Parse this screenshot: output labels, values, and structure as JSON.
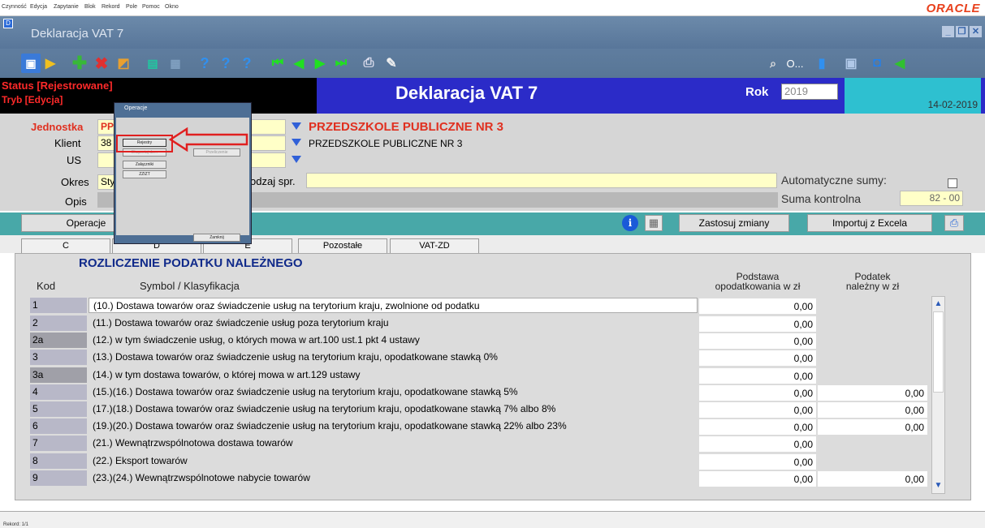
{
  "menu": {
    "items": [
      "Czynność",
      "Edycja",
      "Zapytanie",
      "Blok",
      "Rekord",
      "Pole",
      "Pomoc",
      "Okno"
    ],
    "brand": "ORACLE"
  },
  "window": {
    "title": "Deklaracja VAT 7",
    "icon_label": "D"
  },
  "toolbar": {
    "icons": [
      "save-icon",
      "open-icon",
      "insert-record-icon",
      "delete-record-icon",
      "clear-icon",
      "list-icon",
      "block-icon",
      "query-icon",
      "query-execute-icon",
      "query-count-icon",
      "first-record-icon",
      "prev-record-icon",
      "next-record-icon",
      "last-record-icon",
      "print-icon",
      "edit-icon",
      "zoom-icon",
      "info-icon",
      "window-icon",
      "close-form-icon",
      "exit-icon"
    ],
    "more_label": "O..."
  },
  "status": {
    "line1": "Status [Rejestrowane]",
    "line2": "Tryb [Edycja]",
    "title": "Deklaracja VAT 7",
    "rok_label": "Rok",
    "rok_value": "2019",
    "date": "14-02-2019"
  },
  "header": {
    "jednostka_label": "Jednostka",
    "jednostka_value": "PP",
    "jednostka_name": "PRZEDSZKOLE PUBLICZNE NR 3",
    "klient_label": "Klient",
    "klient_value": "38",
    "klient_name": "PRZEDSZKOLE PUBLICZNE NR 3",
    "us_label": "US",
    "okres_label": "Okres",
    "okres_value": "Sty",
    "rodzaj_label": "odzaj spr.",
    "opis_label": "Opis",
    "auto_label": "Automatyczne sumy:",
    "suma_label": "Suma kontrolna",
    "suma_value": "82 - 00"
  },
  "opbar": {
    "operacje": "Operacje",
    "zastosuj": "Zastosuj zmiany",
    "importuj": "Importuj z Excela"
  },
  "tabs": [
    "C",
    "D",
    "E",
    "Pozostałe",
    "VAT-ZD"
  ],
  "table": {
    "section_title": "ROZLICZENIE PODATKU NALEŻNEGO",
    "col_kod": "Kod",
    "col_symbol": "Symbol / Klasyfikacja",
    "col_podstawa_1": "Podstawa",
    "col_podstawa_2": "opodatkowania w zł",
    "col_podatek_1": "Podatek",
    "col_podatek_2": "należny w zł",
    "rows": [
      {
        "kod": "1",
        "desc": "(10.) Dostawa towarów oraz świadczenie usług na terytorium kraju, zwolnione od podatku",
        "v1": "0,00",
        "v2": ""
      },
      {
        "kod": "2",
        "desc": "(11.) Dostawa towarów oraz świadczenie usług poza terytorium kraju",
        "v1": "0,00",
        "v2": ""
      },
      {
        "kod": "2a",
        "desc": "(12.) w tym świadczenie usług, o których mowa w art.100 ust.1 pkt 4 ustawy",
        "v1": "0,00",
        "v2": ""
      },
      {
        "kod": "3",
        "desc": "(13.) Dostawa towarów oraz świadczenie usług na terytorium kraju, opodatkowane stawką 0%",
        "v1": "0,00",
        "v2": ""
      },
      {
        "kod": "3a",
        "desc": "(14.) w tym dostawa towarów, o której mowa w art.129 ustawy",
        "v1": "0,00",
        "v2": ""
      },
      {
        "kod": "4",
        "desc": "(15.)(16.) Dostawa towarów oraz świadczenie usług na terytorium kraju, opodatkowane stawką 5%",
        "v1": "0,00",
        "v2": "0,00"
      },
      {
        "kod": "5",
        "desc": "(17.)(18.) Dostawa towarów oraz świadczenie usług na terytorium kraju, opodatkowane stawką 7% albo 8%",
        "v1": "0,00",
        "v2": "0,00"
      },
      {
        "kod": "6",
        "desc": "(19.)(20.) Dostawa towarów oraz świadczenie usług na terytorium kraju, opodatkowane stawką 22% albo 23%",
        "v1": "0,00",
        "v2": "0,00"
      },
      {
        "kod": "7",
        "desc": "(21.) Wewnątrzwspólnotowa dostawa towarów",
        "v1": "0,00",
        "v2": ""
      },
      {
        "kod": "8",
        "desc": "(22.) Eksport towarów",
        "v1": "0,00",
        "v2": ""
      },
      {
        "kod": "9",
        "desc": "(23.)(24.) Wewnątrzwspólnotowe nabycie towarów",
        "v1": "0,00",
        "v2": "0,00"
      }
    ]
  },
  "dialog": {
    "title": "Operacje",
    "btn_rejestry": "Rejestry",
    "btn_2": "Eksportuj do...",
    "btn_3": "Przeliczenie",
    "btn_zalaczniki": "Załączniki",
    "btn_zzizt": "ZZIZT",
    "btn_zamknij": "Zamknij"
  },
  "bottombar": {
    "rekord": "Rekord: 1/1"
  }
}
